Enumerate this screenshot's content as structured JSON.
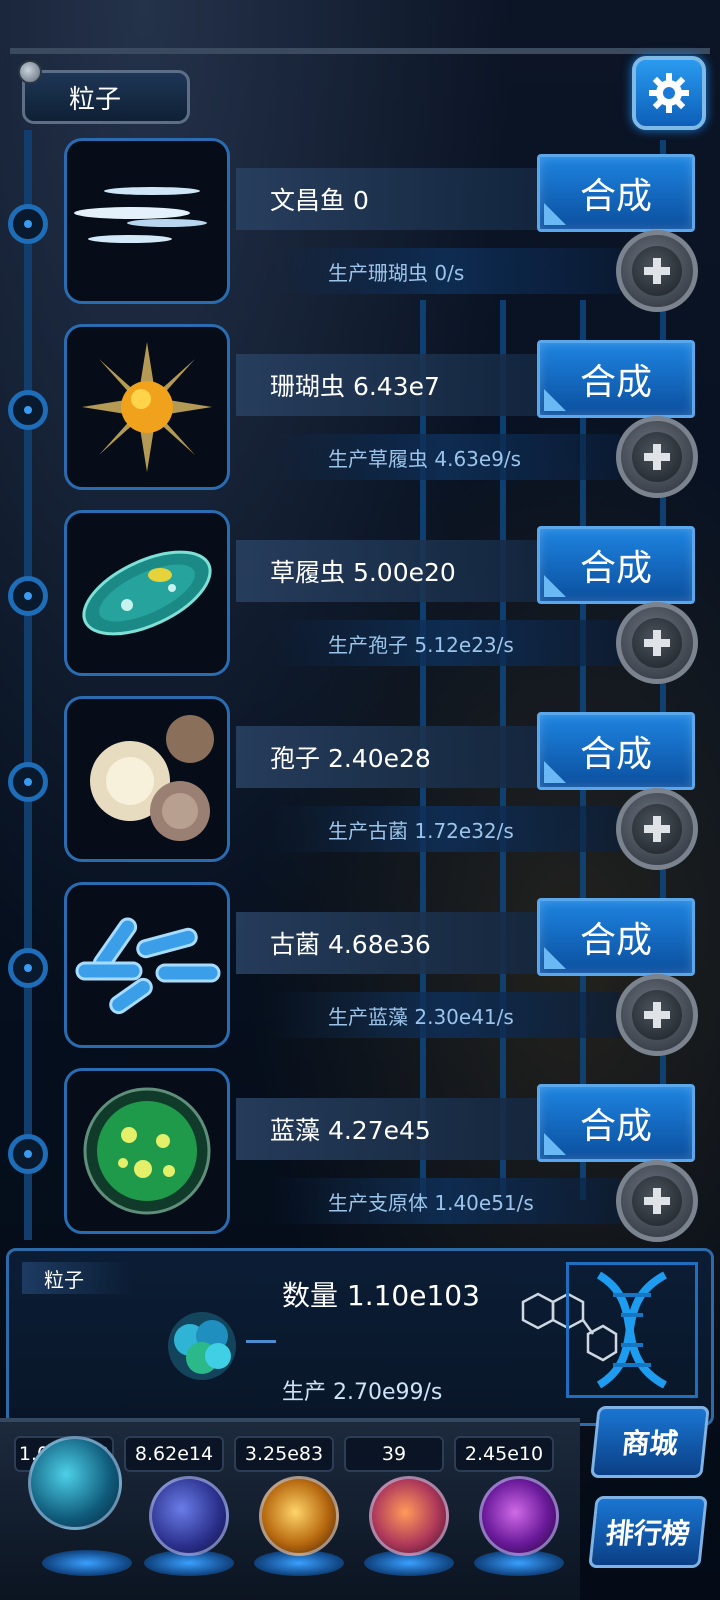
{
  "header": {
    "title": "粒子",
    "settings_icon": "gear-icon"
  },
  "rows": [
    {
      "name": "文昌鱼 0",
      "production": "生产珊瑚虫 0/s",
      "synth_label": "合成",
      "image": "lancelet"
    },
    {
      "name": "珊瑚虫 6.43e7",
      "production": "生产草履虫 4.63e9/s",
      "synth_label": "合成",
      "image": "coral-polyp"
    },
    {
      "name": "草履虫 5.00e20",
      "production": "生产孢子 5.12e23/s",
      "synth_label": "合成",
      "image": "paramecium"
    },
    {
      "name": "孢子 2.40e28",
      "production": "生产古菌 1.72e32/s",
      "synth_label": "合成",
      "image": "spore"
    },
    {
      "name": "古菌 4.68e36",
      "production": "生产蓝藻 2.30e41/s",
      "synth_label": "合成",
      "image": "archaea"
    },
    {
      "name": "蓝藻 4.27e45",
      "production": "生产支原体 1.40e51/s",
      "synth_label": "合成",
      "image": "cyanobacteria"
    }
  ],
  "summary": {
    "tag": "粒子",
    "count": "数量 1.10e103",
    "production": "生产 2.70e99/s"
  },
  "stats": [
    "1.03e103",
    "8.62e14",
    "3.25e83",
    "39",
    "2.45e10"
  ],
  "side_buttons": {
    "shop": "商城",
    "ranking": "排行榜"
  },
  "colors": {
    "accent": "#1e84e0",
    "frame": "#2a6cb1",
    "background": "#050d1c"
  }
}
